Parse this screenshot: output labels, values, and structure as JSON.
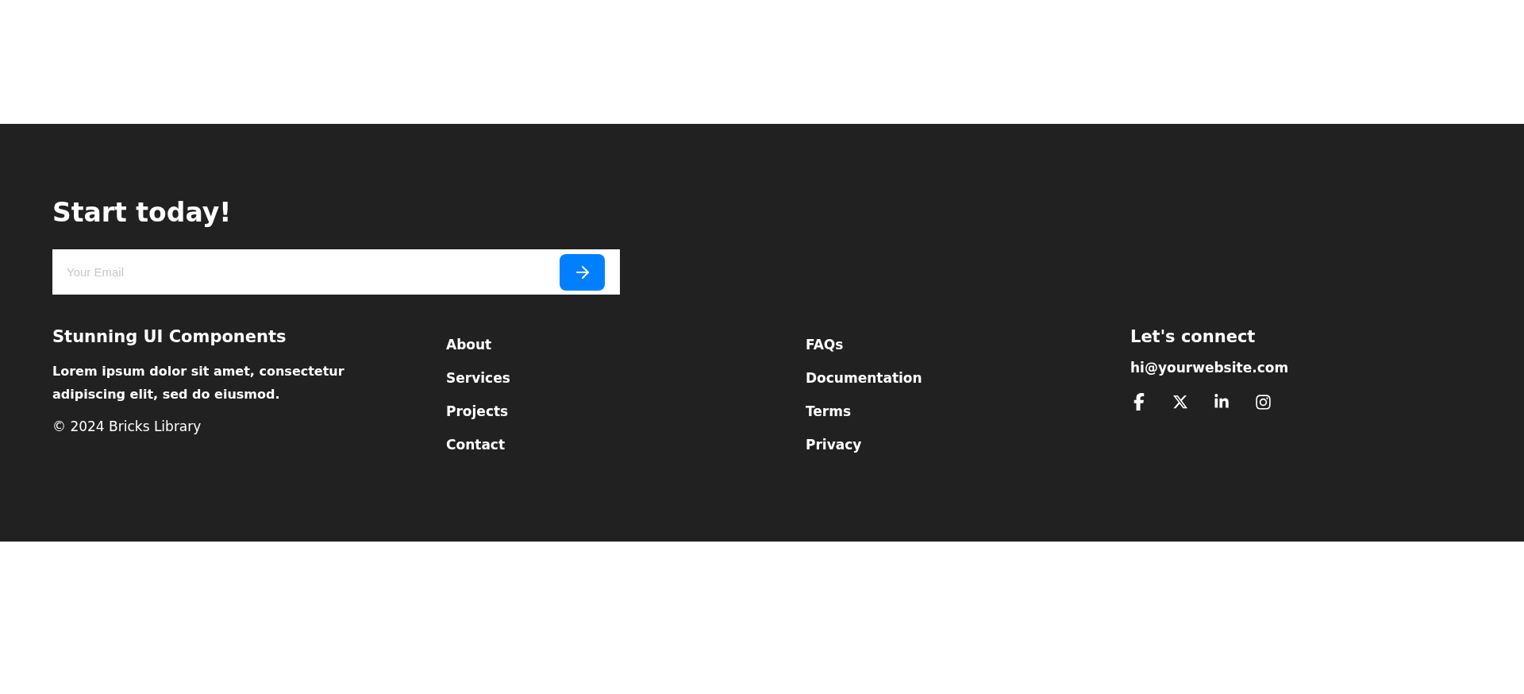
{
  "signup": {
    "title": "Start today!",
    "email_field": {
      "placeholder": "Your Email"
    }
  },
  "about": {
    "title": "Stunning UI Components",
    "text": "Lorem ipsum dolor sit amet, consectetur adipiscing elit, sed do eiusmod.",
    "copyright": "© 2024 Bricks Library"
  },
  "links_1": [
    "About",
    "Services",
    "Projects",
    "Contact"
  ],
  "links_2": [
    "FAQs",
    "Documentation",
    "Terms",
    "Privacy"
  ],
  "connect": {
    "title": "Let's connect",
    "email": "hi@yourwebsite.com",
    "social": [
      {
        "kind": "facebook"
      },
      {
        "kind": "x"
      },
      {
        "kind": "linkedin"
      },
      {
        "kind": "instagram"
      }
    ]
  }
}
